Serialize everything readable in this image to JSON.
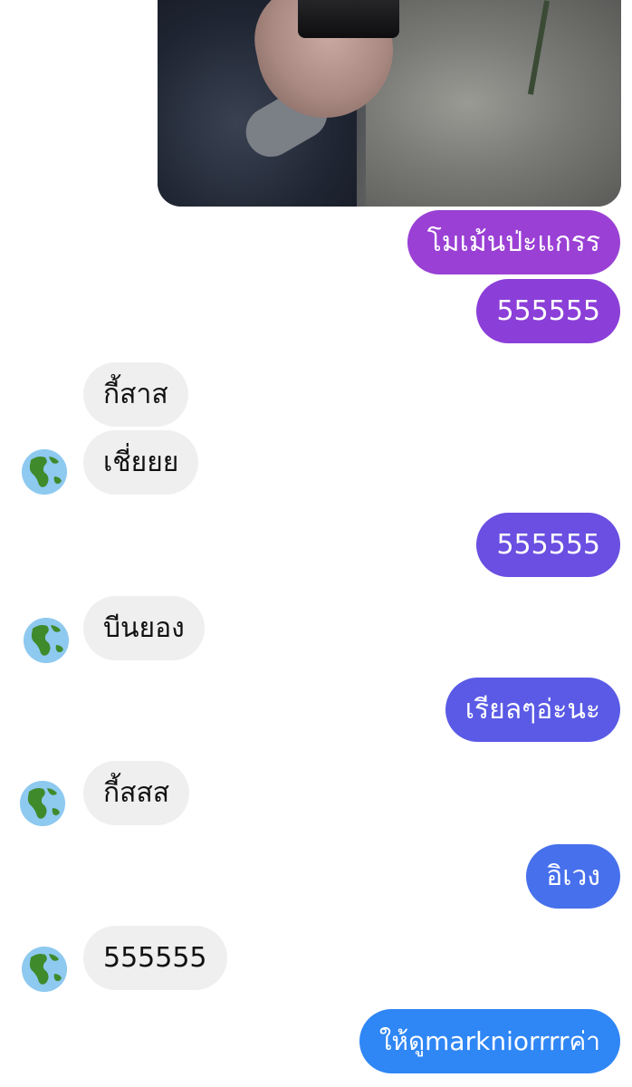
{
  "colors": {
    "incoming_bubble": "#efeff0",
    "outgoing_gradient": [
      "#9a40d4",
      "#8b3ed8",
      "#6a4fe2",
      "#5a5ae6",
      "#4770ec",
      "#2f86f5"
    ]
  },
  "photo": {
    "description_icon": "shared-photo-thumbnail"
  },
  "messages": [
    {
      "direction": "out",
      "text": "โมเม้นป่ะแกรร"
    },
    {
      "direction": "out",
      "text": "555555"
    },
    {
      "direction": "in",
      "text": "กี้สาส"
    },
    {
      "direction": "in",
      "text": "เชี่ยยย",
      "avatar": "earth-globe-icon"
    },
    {
      "direction": "out",
      "text": "555555"
    },
    {
      "direction": "in",
      "text": "บีนยอง",
      "avatar": "earth-globe-icon"
    },
    {
      "direction": "out",
      "text": "เรียลๆอ่ะนะ"
    },
    {
      "direction": "in",
      "text": "กี้สสส",
      "avatar": "earth-globe-icon"
    },
    {
      "direction": "out",
      "text": "อิเวง"
    },
    {
      "direction": "in",
      "text": "555555",
      "avatar": "earth-globe-icon"
    },
    {
      "direction": "out",
      "text": "ให้ดูmarkniorrrrค่า"
    }
  ]
}
